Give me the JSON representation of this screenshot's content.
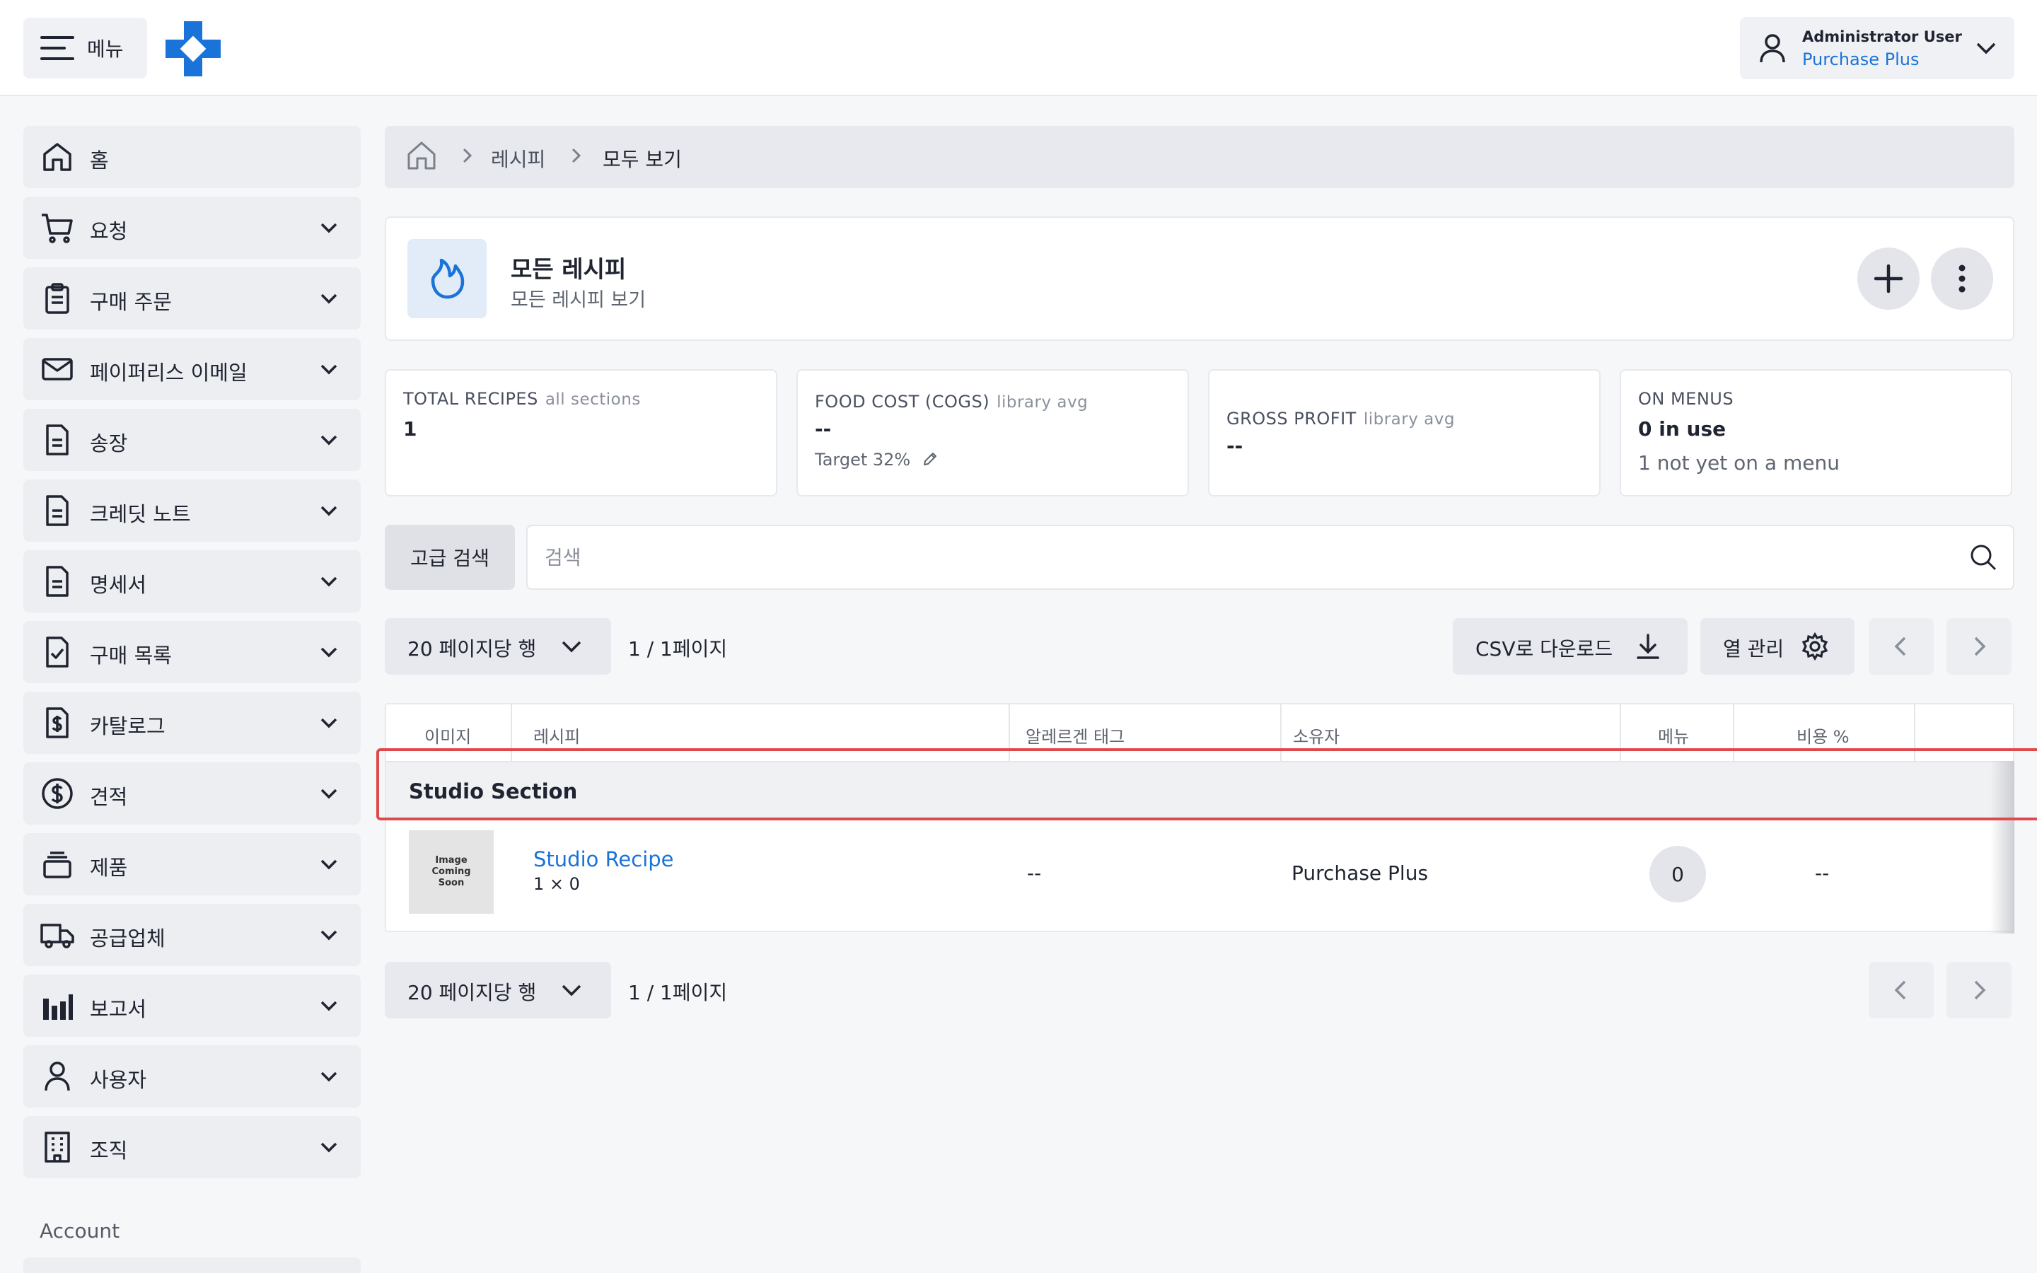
{
  "topbar": {
    "menu_label": "메뉴",
    "user_name": "Administrator User",
    "user_org": "Purchase Plus"
  },
  "sidebar": {
    "items": [
      {
        "label": "홈",
        "icon": "home-icon"
      },
      {
        "label": "요청",
        "icon": "cart-icon"
      },
      {
        "label": "구매 주문",
        "icon": "clipboard-icon"
      },
      {
        "label": "페이퍼리스 이메일",
        "icon": "mail-icon"
      },
      {
        "label": "송장",
        "icon": "document-icon"
      },
      {
        "label": "크레딧 노트",
        "icon": "document-icon"
      },
      {
        "label": "명세서",
        "icon": "document-icon"
      },
      {
        "label": "구매 목록",
        "icon": "checklist-icon"
      },
      {
        "label": "카탈로그",
        "icon": "dollar-document-icon"
      },
      {
        "label": "견적",
        "icon": "dollar-circle-icon"
      },
      {
        "label": "제품",
        "icon": "box-icon"
      },
      {
        "label": "공급업체",
        "icon": "truck-icon"
      },
      {
        "label": "보고서",
        "icon": "bar-chart-icon"
      },
      {
        "label": "사용자",
        "icon": "user-icon"
      },
      {
        "label": "조직",
        "icon": "building-icon"
      }
    ],
    "section_label": "Account"
  },
  "breadcrumb": {
    "items": [
      "레시피",
      "모두 보기"
    ]
  },
  "header": {
    "title": "모든 레시피",
    "subtitle": "모든 레시피 보기"
  },
  "stats": {
    "total_recipes": {
      "label": "TOTAL RECIPES",
      "sub": "all sections",
      "value": "1"
    },
    "food_cost": {
      "label": "FOOD COST (COGS)",
      "sub": "library avg",
      "value": "--",
      "note": "Target 32%"
    },
    "gross_profit": {
      "label": "GROSS PROFIT",
      "sub": "library avg",
      "value": "--"
    },
    "on_menus": {
      "label": "ON MENUS",
      "value": "0 in use",
      "note": "1 not yet on a menu"
    }
  },
  "search": {
    "advanced_label": "고급 검색",
    "placeholder": "검색"
  },
  "pagination": {
    "rows_label": "20 페이지당 행",
    "page_info": "1 / 1페이지"
  },
  "toolbar": {
    "csv_label": "CSV로 다운로드",
    "columns_label": "열 관리"
  },
  "table": {
    "headers": [
      "이미지",
      "레시피",
      "알레르겐 태그",
      "소유자",
      "메뉴",
      "비용 %"
    ],
    "section_title": "Studio Section",
    "rows": [
      {
        "image_text": [
          "Image",
          "Coming",
          "Soon"
        ],
        "recipe": "Studio Recipe",
        "yield": "1 × 0",
        "allergens": "--",
        "owner": "Purchase Plus",
        "menus": "0",
        "cost_pct": "--"
      }
    ]
  },
  "colors": {
    "accent": "#1a73d9",
    "highlight": "#e0494c"
  }
}
